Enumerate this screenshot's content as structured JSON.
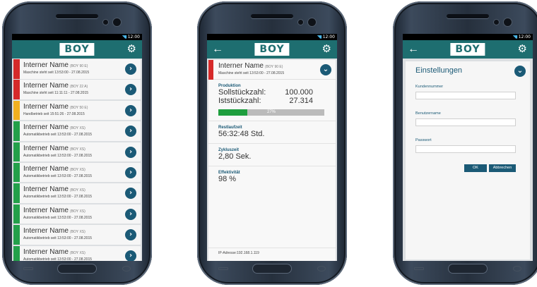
{
  "status": {
    "time": "12:00"
  },
  "app": {
    "logo": "BOY",
    "gear_icon": "gear-icon",
    "back_icon": "back-arrow-icon",
    "chevron_icon": "chevron-right-icon"
  },
  "colors": {
    "red": "#d62a2a",
    "yellow": "#f0b020",
    "green": "#23a04a",
    "teal": "#1e6e70",
    "accent": "#1b5a76"
  },
  "machines": [
    {
      "name": "Interner Name",
      "model": "(BOY 90 E)",
      "status": "Maschine steht seit 13:53:00 - 27.08.2015",
      "color": "#d62a2a"
    },
    {
      "name": "Interner Name",
      "model": "(BOY 22 A)",
      "status": "Maschine steht seit 11:11:11 - 27.08.2015",
      "color": "#d62a2a"
    },
    {
      "name": "Interner Name",
      "model": "(BOY 50 E)",
      "status": "Handbetrieb seit 15:51:26 - 27.08.2015",
      "color": "#f0b020"
    },
    {
      "name": "Interner Name",
      "model": "(BOY XS)",
      "status": "Automatikbetrieb seit 13:53:00 - 27.08.2015",
      "color": "#23a04a"
    },
    {
      "name": "Interner Name",
      "model": "(BOY XS)",
      "status": "Automatikbetrieb seit 13:53:00 - 27.08.2015",
      "color": "#23a04a"
    },
    {
      "name": "Interner Name",
      "model": "(BOY XS)",
      "status": "Automatikbetrieb seit 13:53:00 - 27.08.2015",
      "color": "#23a04a"
    },
    {
      "name": "Interner Name",
      "model": "(BOY XS)",
      "status": "Automatikbetrieb seit 13:53:00 - 27.08.2015",
      "color": "#23a04a"
    },
    {
      "name": "Interner Name",
      "model": "(BOY XS)",
      "status": "Automatikbetrieb seit 13:53:00 - 27.08.2015",
      "color": "#23a04a"
    },
    {
      "name": "Interner Name",
      "model": "(BOY XS)",
      "status": "Automatikbetrieb seit 13:53:00 - 27.08.2015",
      "color": "#23a04a"
    },
    {
      "name": "Interner Name",
      "model": "(BOY XS)",
      "status": "Automatikbetrieb seit 13:53:00 - 27.08.2015",
      "color": "#23a04a"
    }
  ],
  "detail": {
    "name": "Interner Name",
    "model": "(BOY 90 E)",
    "status": "Maschine steht seit 13:53:00 - 27.08.2015",
    "production_label": "Produktion",
    "target_label": "Sollstückzahl:",
    "target_value": "100.000",
    "actual_label": "Iststückzahl:",
    "actual_value": "27.314",
    "progress_percent": 27,
    "progress_text": "27%",
    "runtime_label": "Restlaufzeit",
    "runtime_value": "56:32:48 Std.",
    "cycle_label": "Zykluszeit",
    "cycle_value": "2,80 Sek.",
    "efficiency_label": "Effektivität",
    "efficiency_value": "98 %",
    "ip": "IP-Adresse:192.168.1.119"
  },
  "settings": {
    "title": "Einstellungen",
    "customer_label": "Kundennummer",
    "user_label": "Benutzername",
    "password_label": "Passwort",
    "ok_label": "OK",
    "cancel_label": "Abbrechen"
  }
}
